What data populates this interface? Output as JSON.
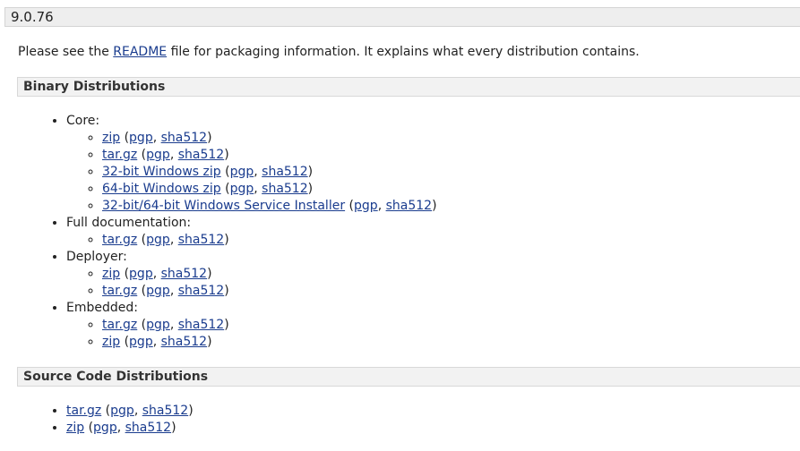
{
  "version_title": "9.0.76",
  "intro": {
    "prefix": "Please see the ",
    "link": "README",
    "suffix": " file for packaging information. It explains what every distribution contains."
  },
  "binary": {
    "heading": "Binary Distributions",
    "groups": [
      {
        "label": "Core:",
        "files": [
          {
            "name": "zip",
            "pgp": "pgp",
            "sha": "sha512"
          },
          {
            "name": "tar.gz",
            "pgp": "pgp",
            "sha": "sha512"
          },
          {
            "name": "32-bit Windows zip",
            "pgp": "pgp",
            "sha": "sha512"
          },
          {
            "name": "64-bit Windows zip",
            "pgp": "pgp",
            "sha": "sha512"
          },
          {
            "name": "32-bit/64-bit Windows Service Installer",
            "pgp": "pgp",
            "sha": "sha512"
          }
        ]
      },
      {
        "label": "Full documentation:",
        "files": [
          {
            "name": "tar.gz",
            "pgp": "pgp",
            "sha": "sha512"
          }
        ]
      },
      {
        "label": "Deployer:",
        "files": [
          {
            "name": "zip",
            "pgp": "pgp",
            "sha": "sha512"
          },
          {
            "name": "tar.gz",
            "pgp": "pgp",
            "sha": "sha512"
          }
        ]
      },
      {
        "label": "Embedded:",
        "files": [
          {
            "name": "tar.gz",
            "pgp": "pgp",
            "sha": "sha512"
          },
          {
            "name": "zip",
            "pgp": "pgp",
            "sha": "sha512"
          }
        ]
      }
    ]
  },
  "source": {
    "heading": "Source Code Distributions",
    "files": [
      {
        "name": "tar.gz",
        "pgp": "pgp",
        "sha": "sha512"
      },
      {
        "name": "zip",
        "pgp": "pgp",
        "sha": "sha512"
      }
    ]
  },
  "punct": {
    "open": " (",
    "sep": ", ",
    "close": ")"
  }
}
